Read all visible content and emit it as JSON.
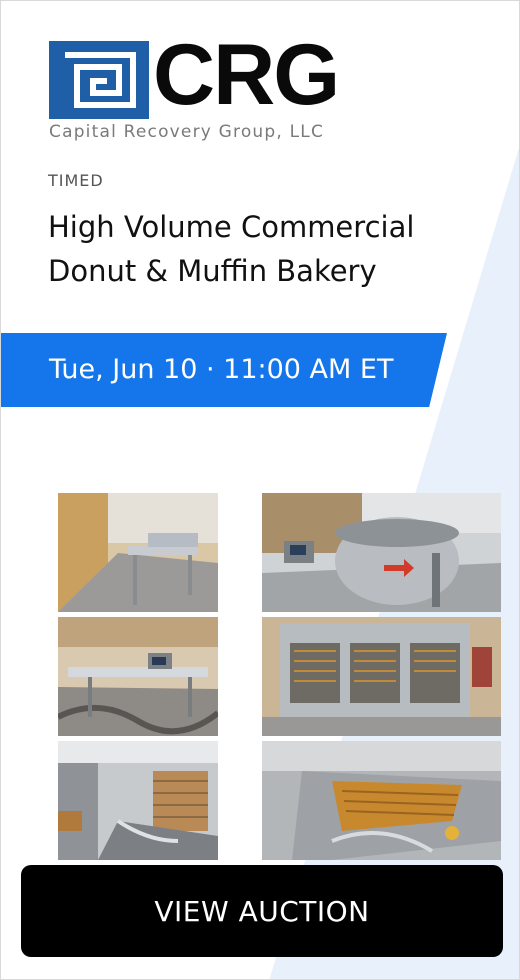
{
  "brand": {
    "wordmark": "CRG",
    "subtitle": "Capital Recovery Group, LLC",
    "colors": {
      "mark_blue": "#1e5fa8",
      "wordmark": "#0a0a0a"
    }
  },
  "auction": {
    "type_label": "TIMED",
    "title": "High Volume Commercial Donut & Muffin Bakery",
    "date_time": "Tue, Jun 10 · 11:00 AM ET"
  },
  "colors": {
    "accent": "#1476ea",
    "stripe": "#e8f0fb",
    "cta_bg": "#000000",
    "cta_text": "#ffffff"
  },
  "photos": [
    {
      "subject": "bakery-production-line"
    },
    {
      "subject": "dough-mixer"
    },
    {
      "subject": "dough-sheeter"
    },
    {
      "subject": "proofer-cabinets"
    },
    {
      "subject": "donut-fryer-line"
    },
    {
      "subject": "donut-glazer-conveyor"
    }
  ],
  "cta": {
    "label": "VIEW AUCTION"
  }
}
